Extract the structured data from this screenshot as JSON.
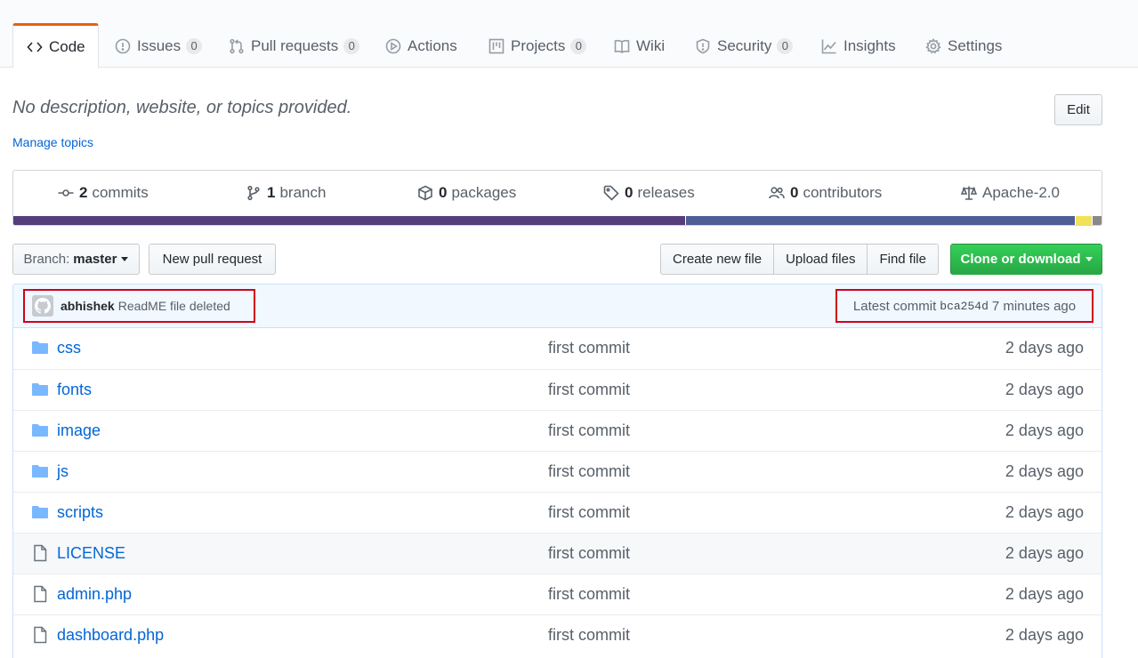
{
  "tabs": [
    {
      "name": "tab-code",
      "label": "Code",
      "icon": "code-icon",
      "counter": null,
      "selected": true
    },
    {
      "name": "tab-issues",
      "label": "Issues",
      "icon": "issue-opened-icon",
      "counter": "0"
    },
    {
      "name": "tab-pull-requests",
      "label": "Pull requests",
      "icon": "git-pull-request-icon",
      "counter": "0"
    },
    {
      "name": "tab-actions",
      "label": "Actions",
      "icon": "play-icon",
      "counter": null
    },
    {
      "name": "tab-projects",
      "label": "Projects",
      "icon": "project-icon",
      "counter": "0"
    },
    {
      "name": "tab-wiki",
      "label": "Wiki",
      "icon": "book-icon",
      "counter": null
    },
    {
      "name": "tab-security",
      "label": "Security",
      "icon": "shield-icon",
      "counter": "0"
    },
    {
      "name": "tab-insights",
      "label": "Insights",
      "icon": "graph-icon",
      "counter": null
    },
    {
      "name": "tab-settings",
      "label": "Settings",
      "icon": "gear-icon",
      "counter": null
    }
  ],
  "repo": {
    "description": "No description, website, or topics provided.",
    "manage_topics": "Manage topics",
    "edit_label": "Edit"
  },
  "summary": {
    "commits": {
      "count": "2",
      "label": "commits"
    },
    "branch": {
      "count": "1",
      "label": "branch"
    },
    "packages": {
      "count": "0",
      "label": "packages"
    },
    "releases": {
      "count": "0",
      "label": "releases"
    },
    "contributors": {
      "count": "0",
      "label": "contributors"
    },
    "license": "Apache-2.0",
    "languages": [
      {
        "color": "#563d7c",
        "percent": 61.9
      },
      {
        "color": "#4f5d95",
        "percent": 35.8
      },
      {
        "color": "#f1e05a",
        "percent": 1.5
      },
      {
        "color": "#89898a",
        "percent": 0.8
      }
    ]
  },
  "file_nav": {
    "branch_label": "Branch:",
    "branch_value": "master",
    "new_pull_request": "New pull request",
    "create_new_file": "Create new file",
    "upload_files": "Upload files",
    "find_file": "Find file",
    "clone_or_download": "Clone or download"
  },
  "latest_commit": {
    "author": "abhishek",
    "message": "ReadME file deleted",
    "prefix": "Latest commit",
    "sha": "bca254d",
    "age": "7 minutes ago"
  },
  "files": [
    {
      "type": "dir",
      "name": "css",
      "message": "first commit",
      "age": "2 days ago"
    },
    {
      "type": "dir",
      "name": "fonts",
      "message": "first commit",
      "age": "2 days ago"
    },
    {
      "type": "dir",
      "name": "image",
      "message": "first commit",
      "age": "2 days ago"
    },
    {
      "type": "dir",
      "name": "js",
      "message": "first commit",
      "age": "2 days ago"
    },
    {
      "type": "dir",
      "name": "scripts",
      "message": "first commit",
      "age": "2 days ago"
    },
    {
      "type": "file",
      "name": "LICENSE",
      "message": "first commit",
      "age": "2 days ago",
      "highlighted": true
    },
    {
      "type": "file",
      "name": "admin.php",
      "message": "first commit",
      "age": "2 days ago"
    },
    {
      "type": "file",
      "name": "dashboard.php",
      "message": "first commit",
      "age": "2 days ago"
    }
  ],
  "colors": {
    "link": "#0366d6",
    "accent_tab": "#e36209",
    "clone_green": "#28a745",
    "annotation_red": "#d0021b",
    "folder": "#79b8ff"
  }
}
